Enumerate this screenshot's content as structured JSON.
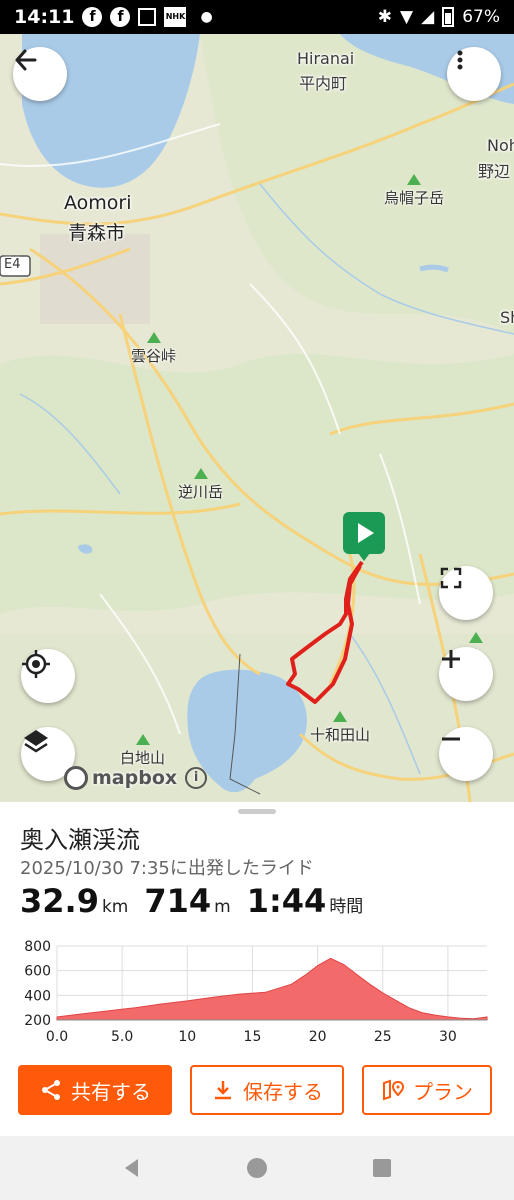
{
  "status": {
    "time": "14:11",
    "battery": "67%",
    "nhk": "NHK"
  },
  "map": {
    "labels": {
      "aomori_en": "Aomori",
      "aomori_jp": "青森市",
      "hiranai_en": "Hiranai",
      "hiranai_jp": "平内町",
      "noheji_en": "Noh",
      "noheji_jp": "野辺",
      "shi": "Sh",
      "e4": "E4",
      "peak1": "烏帽子岳",
      "peak2": "雲谷峠",
      "peak3": "逆川岳",
      "peak4": "十和田山",
      "peak5": "白地山",
      "peak6": "山"
    },
    "mapbox": "mapbox",
    "colors": {
      "route": "#e0201a",
      "start": "#1a9a55",
      "water": "#a9cbe8"
    }
  },
  "ride": {
    "title": "奥入瀬渓流",
    "subtitle": "2025/10/30 7:35に出発したライド",
    "distance": {
      "value": "32.9",
      "unit": "km"
    },
    "elevation": {
      "value": "714",
      "unit": "m"
    },
    "duration": {
      "value": "1:44",
      "unit": "時間"
    }
  },
  "chart_data": {
    "type": "area",
    "xlabel": "",
    "ylabel": "",
    "xlim": [
      0,
      33
    ],
    "ylim": [
      200,
      800
    ],
    "xticks": [
      "0.0",
      "5.0",
      "10",
      "15",
      "20",
      "25",
      "30"
    ],
    "yticks": [
      "800",
      "600",
      "400",
      "200"
    ],
    "color": "#f36a6a",
    "x": [
      0,
      2,
      4,
      6,
      8,
      10,
      12,
      14,
      16,
      18,
      19,
      20,
      21,
      22,
      23,
      24,
      25,
      26,
      27,
      28,
      29,
      30,
      31,
      32,
      33
    ],
    "y": [
      225,
      250,
      275,
      300,
      330,
      355,
      385,
      410,
      425,
      490,
      560,
      640,
      700,
      650,
      570,
      490,
      420,
      360,
      300,
      260,
      240,
      225,
      215,
      210,
      225
    ]
  },
  "actions": {
    "share": "共有する",
    "save": "保存する",
    "plan": "プラン"
  }
}
